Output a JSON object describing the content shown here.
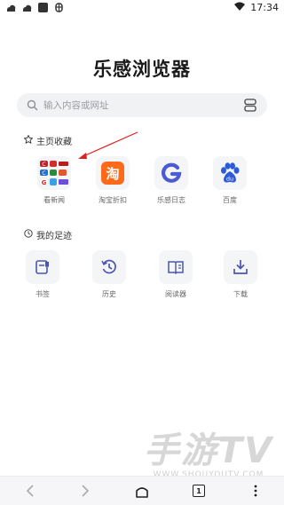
{
  "status": {
    "time": "17:34",
    "left_icons": [
      "weather-icon",
      "weather-icon",
      "image-icon",
      "bug-icon"
    ]
  },
  "browser": {
    "title": "乐感浏览器",
    "search_placeholder": "输入内容或网址"
  },
  "favorites": {
    "title": "主页收藏",
    "items": [
      {
        "label": "看新闻",
        "icon": "news-grid-icon"
      },
      {
        "label": "淘宝折扣",
        "icon": "taobao-icon",
        "glyph": "淘",
        "color": "#ff6a1a"
      },
      {
        "label": "乐感日志",
        "icon": "g-logo-icon",
        "color": "#4c5bd4"
      },
      {
        "label": "百度",
        "icon": "baidu-paw-icon",
        "color": "#2d5bd8"
      }
    ],
    "news_tiles": [
      "C",
      "C",
      "G"
    ]
  },
  "footprints": {
    "title": "我的足迹",
    "items": [
      {
        "label": "书签",
        "icon": "bookmark-icon"
      },
      {
        "label": "历史",
        "icon": "history-icon"
      },
      {
        "label": "阅读器",
        "icon": "reader-icon"
      },
      {
        "label": "下载",
        "icon": "download-icon"
      }
    ]
  },
  "bottom_nav": {
    "tab_count": "1",
    "items": [
      "back-icon",
      "forward-icon",
      "home-icon",
      "tabs-icon",
      "more-icon"
    ]
  },
  "watermark": {
    "main": "手游TV",
    "sub": "WWW.SHOUYOUTV.COM"
  },
  "colors": {
    "accent": "#4a55b3",
    "icon_bg": "#f4f5f7",
    "annotation_arrow": "#e02020"
  }
}
